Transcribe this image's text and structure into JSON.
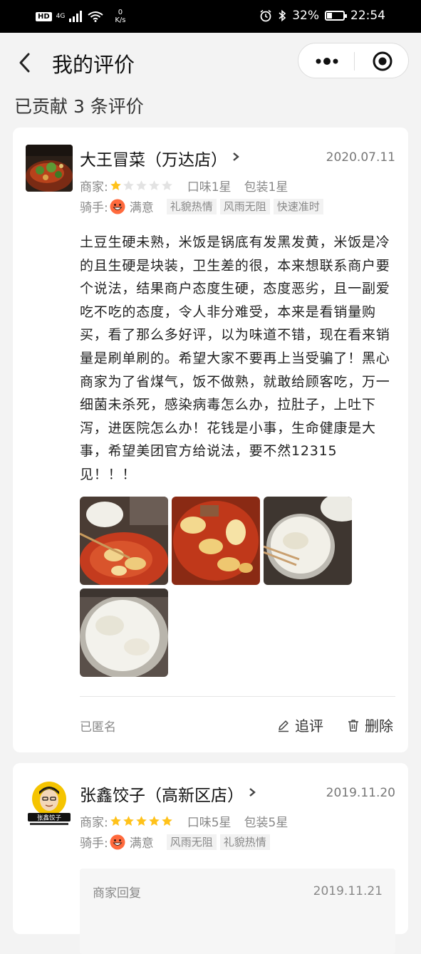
{
  "status_bar": {
    "hd": "HD",
    "network": "4G",
    "speed_value": "0",
    "speed_unit": "K/s",
    "battery": "32%",
    "battery_level": 0.32,
    "time": "22:54"
  },
  "header": {
    "title": "我的评价"
  },
  "summary": "已贡献 3 条评价",
  "reviews": [
    {
      "shop": "大王冒菜（万达店）",
      "date": "2020.07.11",
      "merchant_label": "商家:",
      "rating": 1,
      "taste": "口味1星",
      "packaging": "包装1星",
      "rider_label": "骑手:",
      "rider_mood": "满意",
      "tags": [
        "礼貌热情",
        "风雨无阻",
        "快速准时"
      ],
      "text": "土豆生硬未熟，米饭是锅底有发黑发黄，米饭是冷的且生硬是块装，卫生差的很，本来想联系商户要个说法，结果商户态度生硬，态度恶劣，且一副爱吃不吃的态度，令人非分难受，本来是看销量购买，看了那么多好评，以为味道不错，现在看来销量是刷单刷的。希望大家不要再上当受骗了！黑心商家为了省煤气，饭不做熟，就敢给顾客吃，万一细菌未杀死，感染病毒怎么办，拉肚子，上吐下泻，进医院怎么办！花钱是小事，生命健康是大事，希望美团官方给说法，要不然12315见！！！",
      "anonymous": "已匿名",
      "followup": "追评",
      "delete": "删除"
    },
    {
      "shop": "张鑫饺子（高新区店）",
      "date": "2019.11.20",
      "merchant_label": "商家:",
      "rating": 5,
      "taste": "口味5星",
      "packaging": "包装5星",
      "rider_label": "骑手:",
      "rider_mood": "满意",
      "tags": [
        "风雨无阻",
        "礼貌热情"
      ],
      "reply_label": "商家回复",
      "reply_date": "2019.11.21"
    }
  ],
  "logo_text": "张鑫饺子",
  "colors": {
    "star_active": "#ffc21a",
    "star_inactive": "#e3e3e3",
    "tag_bg": "#f2f2f2"
  }
}
